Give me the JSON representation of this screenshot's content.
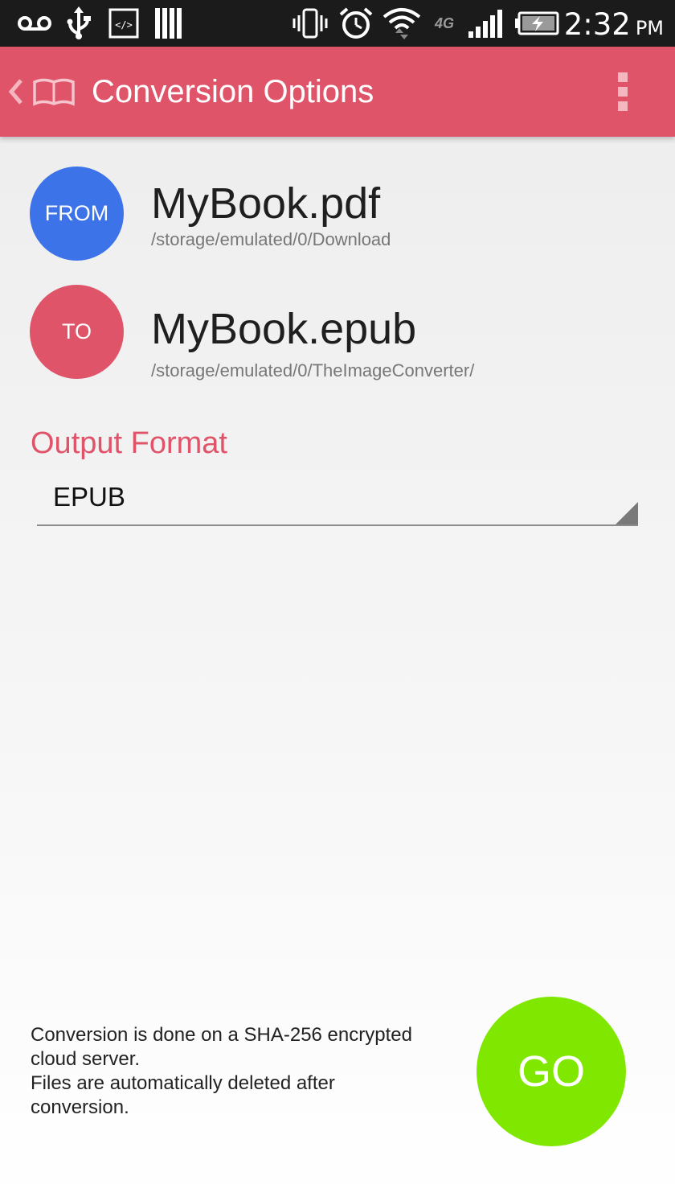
{
  "status_bar": {
    "time": "2:32",
    "ampm": "PM",
    "network_label": "4G",
    "icons": [
      "voicemail-icon",
      "usb-icon",
      "code-icon",
      "library-icon",
      "vibrate-icon",
      "alarm-icon",
      "wifi-icon",
      "network-4g-icon",
      "signal-icon",
      "battery-charging-icon"
    ]
  },
  "app_bar": {
    "title": "Conversion Options",
    "color": "#e0546a"
  },
  "source": {
    "badge": "FROM",
    "file_name": "MyBook.pdf",
    "path": "/storage/emulated/0/Download",
    "color": "#3d73e8"
  },
  "target": {
    "badge": "TO",
    "file_name": "MyBook.epub",
    "path": "/storage/emulated/0/TheImageConverter/",
    "color": "#e0546a"
  },
  "output_format": {
    "label": "Output Format",
    "selected": "EPUB"
  },
  "footer": {
    "note_lines": [
      "Conversion is done on a SHA-256 encrypted",
      "cloud server.",
      "Files are automatically deleted after",
      "conversion."
    ],
    "go_label": "GO",
    "go_color": "#80e800"
  }
}
